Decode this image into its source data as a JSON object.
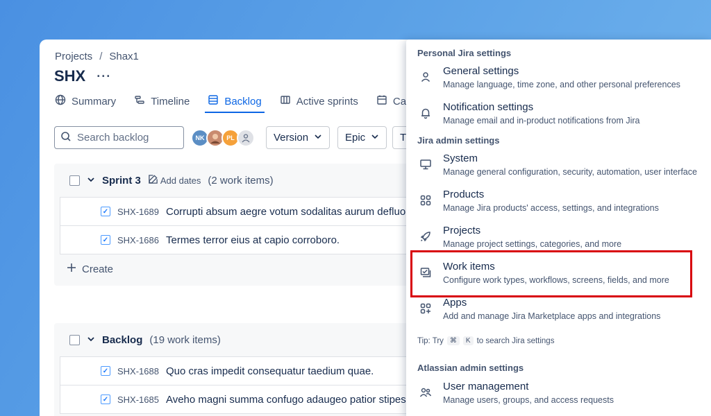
{
  "breadcrumb": {
    "projects": "Projects",
    "sep": "/",
    "project": "Shax1"
  },
  "project": {
    "key": "SHX",
    "more": "···"
  },
  "tabs": [
    {
      "label": "Summary",
      "icon": "globe-icon"
    },
    {
      "label": "Timeline",
      "icon": "timeline-icon"
    },
    {
      "label": "Backlog",
      "icon": "backlog-icon",
      "active": true
    },
    {
      "label": "Active sprints",
      "icon": "board-icon"
    },
    {
      "label": "Ca",
      "icon": "calendar-icon"
    }
  ],
  "toolbar": {
    "search_placeholder": "Search backlog",
    "avatars": [
      "NK",
      "",
      "PL",
      ""
    ],
    "version": "Version",
    "epic": "Epic",
    "type_partial": "T"
  },
  "sprint": {
    "name": "Sprint 3",
    "add_dates": "Add dates",
    "count": "(2 work items)",
    "items": [
      {
        "key": "SHX-1689",
        "summary": "Corrupti absum aegre votum sodalitas aurum defluo"
      },
      {
        "key": "SHX-1686",
        "summary": "Termes terror eius at capio corroboro."
      }
    ],
    "create": "Create"
  },
  "backlog": {
    "name": "Backlog",
    "count": "(19 work items)",
    "items": [
      {
        "key": "SHX-1688",
        "summary": "Quo cras impedit consequatur taedium quae."
      },
      {
        "key": "SHX-1685",
        "summary": "Aveho magni summa confugo adaugeo patior stipes."
      }
    ]
  },
  "menu": {
    "personal_title": "Personal Jira settings",
    "general": {
      "title": "General settings",
      "desc": "Manage language, time zone, and other personal preferences"
    },
    "notification": {
      "title": "Notification settings",
      "desc": "Manage email and in-product notifications from Jira"
    },
    "admin_title": "Jira admin settings",
    "system": {
      "title": "System",
      "desc": "Manage general configuration, security, automation, user interface"
    },
    "products": {
      "title": "Products",
      "desc": "Manage Jira products' access, settings, and integrations"
    },
    "projects": {
      "title": "Projects",
      "desc": "Manage project settings, categories, and more"
    },
    "work_items": {
      "title": "Work items",
      "desc": "Configure work types, workflows, screens, fields, and more"
    },
    "apps": {
      "title": "Apps",
      "desc": "Add and manage Jira Marketplace apps and integrations"
    },
    "tip_prefix": "Tip: Try",
    "tip_key1": "⌘",
    "tip_key2": "K",
    "tip_suffix": "to search Jira settings",
    "atlassian_title": "Atlassian admin settings",
    "user_mgmt": {
      "title": "User management",
      "desc": "Manage users, groups, and access requests"
    }
  },
  "colors": {
    "accent": "#0c66e4",
    "highlight": "#d8000c"
  }
}
